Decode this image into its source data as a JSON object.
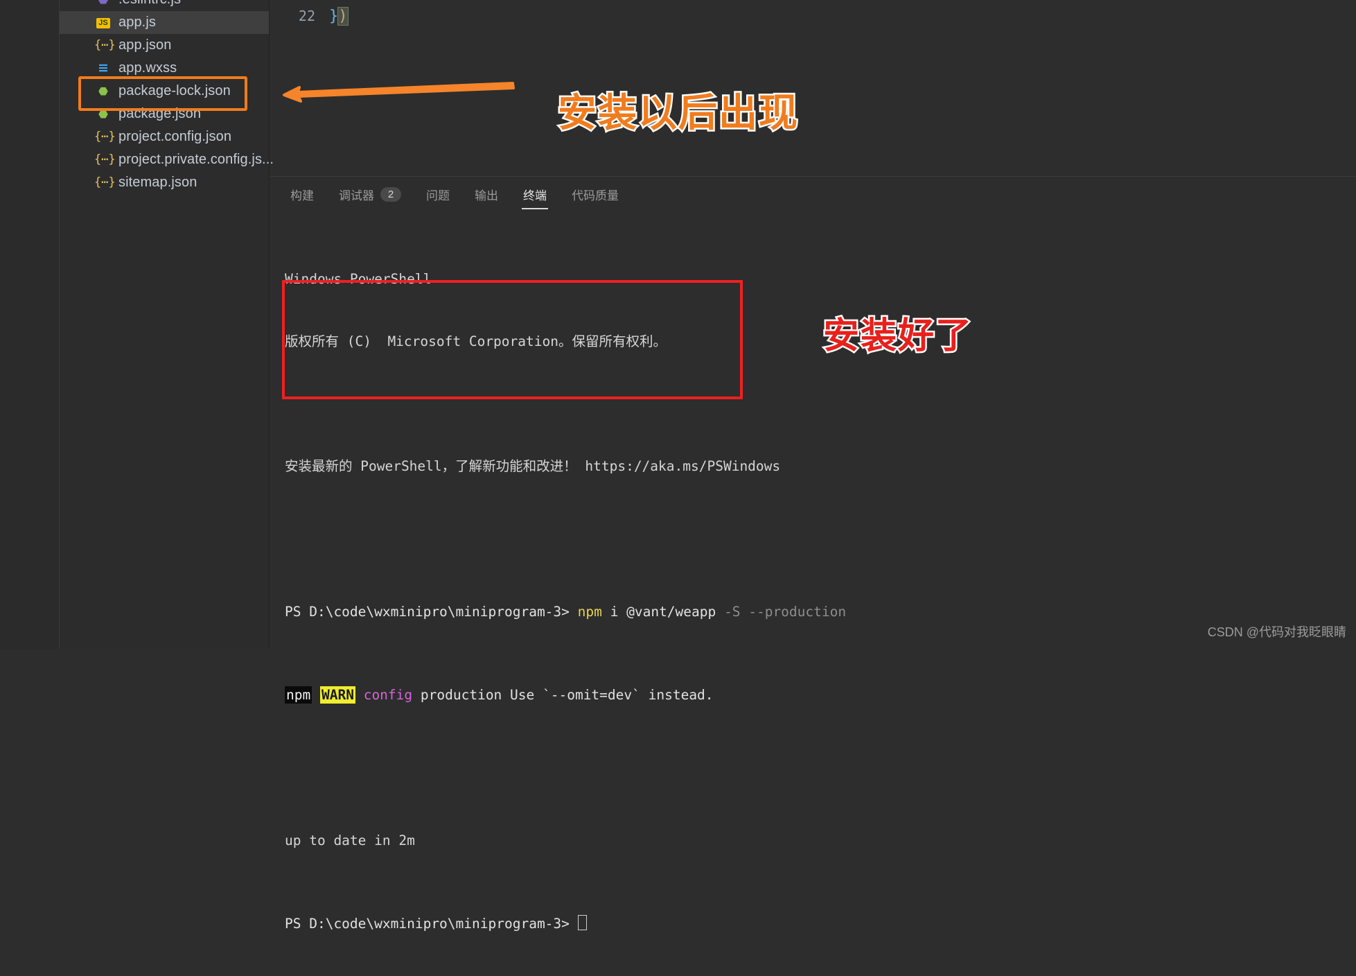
{
  "colors": {
    "accent_orange": "#f07c1e",
    "accent_red": "#ef2020",
    "editor_bg": "#2d2d2d",
    "sidebar_bg": "#2c2c2c",
    "selected_row": "#3f3f3f",
    "warn_highlight": "#f0ec2f"
  },
  "explorer": {
    "files": [
      {
        "name": ".eslintrc.js",
        "icon": "eslint-icon",
        "icon_glyph": "⬣",
        "selected": false,
        "partial": true
      },
      {
        "name": "app.js",
        "icon": "js-file-icon",
        "icon_glyph": "JS",
        "selected": true,
        "partial": false
      },
      {
        "name": "app.json",
        "icon": "json-file-icon",
        "icon_glyph": "{…}",
        "selected": false,
        "partial": false
      },
      {
        "name": "app.wxss",
        "icon": "css-file-icon",
        "icon_glyph": "≡",
        "selected": false,
        "partial": false
      },
      {
        "name": "package-lock.json",
        "icon": "nodejs-file-icon",
        "icon_glyph": "⬣",
        "selected": false,
        "partial": false
      },
      {
        "name": "package.json",
        "icon": "nodejs-file-icon",
        "icon_glyph": "⬣",
        "selected": false,
        "partial": false
      },
      {
        "name": "project.config.json",
        "icon": "json-file-icon",
        "icon_glyph": "{…}",
        "selected": false,
        "partial": false
      },
      {
        "name": "project.private.config.js...",
        "icon": "json-file-icon",
        "icon_glyph": "{…}",
        "selected": false,
        "partial": false
      },
      {
        "name": "sitemap.json",
        "icon": "json-file-icon",
        "icon_glyph": "{…}",
        "selected": false,
        "partial": false
      }
    ]
  },
  "editor": {
    "line_number": "22",
    "code_brace": "}",
    "code_paren": ")"
  },
  "panel": {
    "tabs": [
      {
        "label": "构建",
        "badge": null,
        "active": false
      },
      {
        "label": "调试器",
        "badge": "2",
        "active": false
      },
      {
        "label": "问题",
        "badge": null,
        "active": false
      },
      {
        "label": "输出",
        "badge": null,
        "active": false
      },
      {
        "label": "终端",
        "badge": null,
        "active": true
      },
      {
        "label": "代码质量",
        "badge": null,
        "active": false
      }
    ]
  },
  "terminal": {
    "header_line_1": "Windows PowerShell",
    "header_line_2": "版权所有 (C)  Microsoft Corporation。保留所有权利。",
    "header_line_3": "安装最新的 PowerShell，了解新功能和改进！ https://aka.ms/PSWindows",
    "prompt": "PS D:\\code\\wxminipro\\miniprogram-3>",
    "command_npm": "npm",
    "command_args": " i @vant/weapp",
    "command_flags": " -S --production",
    "warn_npm": "npm",
    "warn_label": "WARN",
    "warn_config": "config",
    "warn_message": " production Use `--omit=dev` instead.",
    "result_line": "up to date in 2m",
    "final_prompt": "PS D:\\code\\wxminipro\\miniprogram-3>"
  },
  "annotations": {
    "orange_text": "安装以后出现",
    "red_text": "安装好了",
    "arrow": "left-arrow-icon"
  },
  "watermark": {
    "text": "CSDN @代码对我眨眼睛"
  }
}
